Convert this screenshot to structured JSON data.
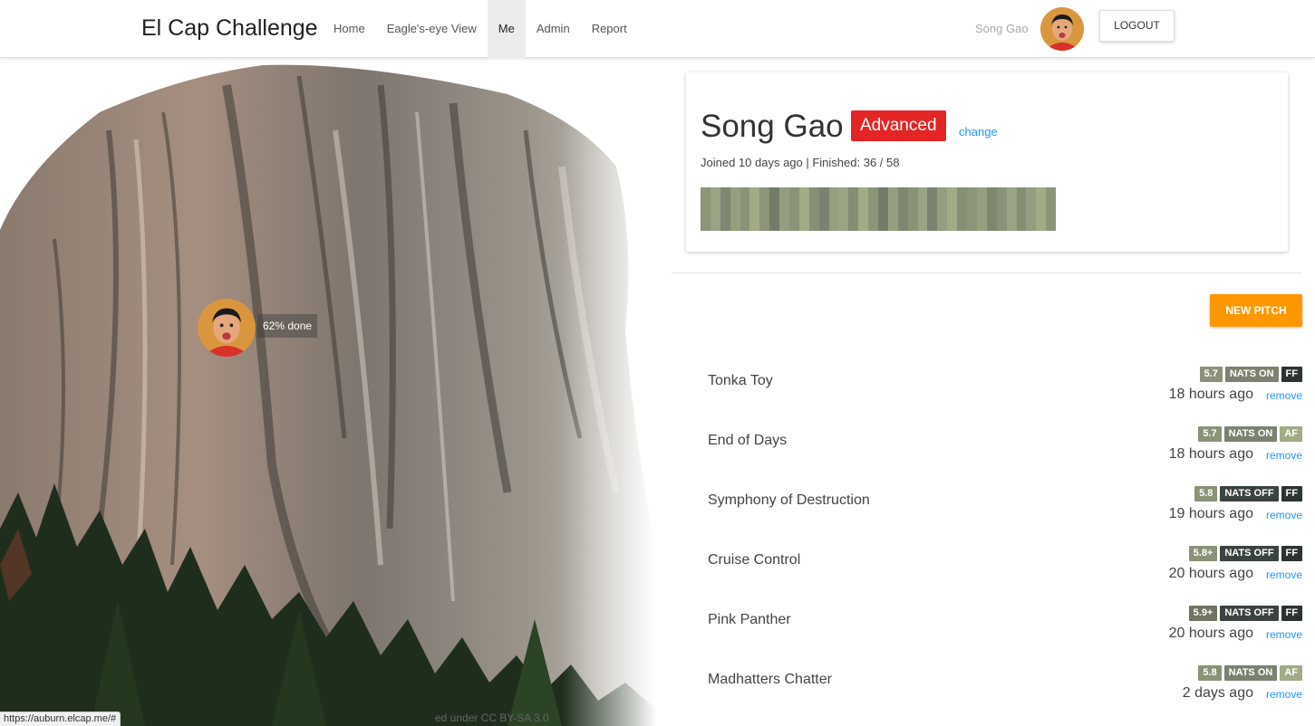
{
  "nav": {
    "brand": "El Cap Challenge",
    "links": [
      "Home",
      "Eagle's-eye View",
      "Me",
      "Admin",
      "Report"
    ],
    "active": "Me",
    "user_name": "Song Gao",
    "logout": "LOGOUT"
  },
  "hero": {
    "progress_label": "62% done",
    "credit": "ed under CC BY-SA 3.0"
  },
  "status_bar": {
    "url": "https://auburn.elcap.me/#"
  },
  "profile": {
    "name": "Song Gao",
    "level": "Advanced",
    "change": "change",
    "meta": "Joined 10 days ago | Finished: 36 / 58"
  },
  "actions": {
    "new_pitch": "NEW PITCH",
    "remove": "remove"
  },
  "colors": {
    "accent_orange": "#ff9800",
    "level_red": "#e32526",
    "link_blue": "#2196f3",
    "tag_grade": "#8a9378",
    "tag_nats_on": "#7b8270",
    "tag_nats_off": "#3b4340",
    "tag_af": "#a1ab86",
    "tag_ff": "#2d3330"
  },
  "pitches": [
    {
      "name": "Tonka Toy",
      "grade": "5.7",
      "nats": "NATS ON",
      "style": "FF",
      "time": "18 hours ago"
    },
    {
      "name": "End of Days",
      "grade": "5.7",
      "nats": "NATS ON",
      "style": "AF",
      "time": "18 hours ago"
    },
    {
      "name": "Symphony of Destruction",
      "grade": "5.8",
      "nats": "NATS OFF",
      "style": "FF",
      "time": "19 hours ago"
    },
    {
      "name": "Cruise Control",
      "grade": "5.8+",
      "nats": "NATS OFF",
      "style": "FF",
      "time": "20 hours ago"
    },
    {
      "name": "Pink Panther",
      "grade": "5.9+",
      "nats": "NATS OFF",
      "style": "FF",
      "time": "20 hours ago"
    },
    {
      "name": "Madhatters Chatter",
      "grade": "5.8",
      "nats": "NATS ON",
      "style": "AF",
      "time": "2 days ago"
    }
  ]
}
